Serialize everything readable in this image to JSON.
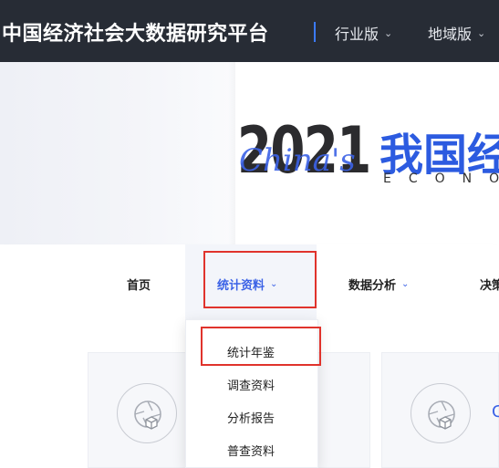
{
  "header": {
    "title": "中国经济社会大数据研究平台",
    "menus": [
      {
        "label": "行业版",
        "chevron": "⌄"
      },
      {
        "label": "地域版",
        "chevron": "⌄"
      }
    ]
  },
  "banner": {
    "year": "2021",
    "script_text": "China's",
    "headline": "我国经",
    "subline": "ECONO"
  },
  "nav": {
    "items": [
      {
        "label": "首页"
      },
      {
        "label": "统计资料",
        "chevron": "⌄",
        "active": true
      },
      {
        "label": "数据分析",
        "chevron": "⌄"
      },
      {
        "label": "决策"
      }
    ]
  },
  "dropdown": {
    "items": [
      "统计年鉴",
      "调查资料",
      "分析报告",
      "普查资料"
    ]
  },
  "cards": {
    "right_letter": "C",
    "icon": "camera-shutter-box-icon"
  },
  "colors": {
    "header_bg": "#272c35",
    "accent": "#3b62e6",
    "highlight": "#e0332c"
  }
}
